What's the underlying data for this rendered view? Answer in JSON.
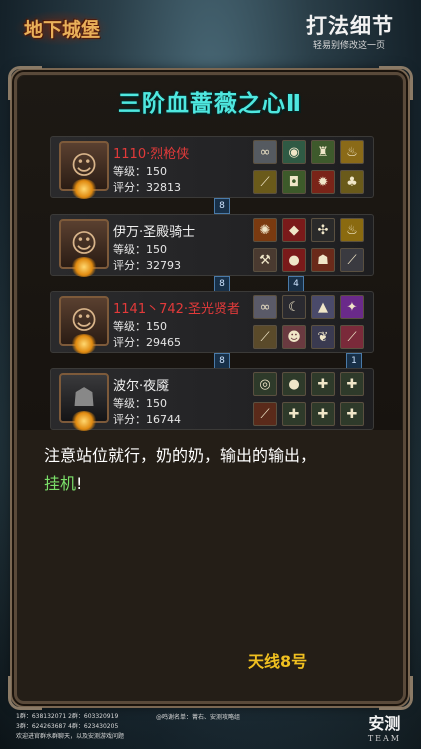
{
  "header": {
    "logo_text": "地下城堡",
    "title": "打法细节",
    "subtitle": "轻易别修改这一页"
  },
  "boss_title": "三阶血蔷薇之心Ⅱ",
  "members": [
    {
      "name": "1110·烈枪侠",
      "name_color": "red",
      "level": "等级：150",
      "score": "评分：32813",
      "portrait_icon": "female-warrior-portrait",
      "skills": [
        {
          "icon": "chain-icon",
          "bg": "#555a60",
          "glyph": "∞"
        },
        {
          "icon": "swirl-icon",
          "bg": "#2f5a44",
          "glyph": "◉"
        },
        {
          "icon": "totem-icon",
          "bg": "#3e5a2c",
          "glyph": "♜"
        },
        {
          "icon": "potion-icon",
          "bg": "#8a6a18",
          "glyph": "♨"
        },
        {
          "icon": "spear-icon",
          "bg": "#6a5a1a",
          "glyph": "⟋"
        },
        {
          "icon": "armor-icon",
          "bg": "#3d5a2a",
          "glyph": "◘"
        },
        {
          "icon": "fire-icon",
          "bg": "#7a2418",
          "glyph": "✹"
        },
        {
          "icon": "rune-icon",
          "bg": "#6a5a1a",
          "glyph": "♣"
        }
      ]
    },
    {
      "name": "伊万·圣殿骑士",
      "name_color": "white",
      "level": "等级：150",
      "score": "评分：32793",
      "portrait_icon": "blonde-knight-portrait",
      "skills": [
        {
          "icon": "flame-ring-icon",
          "bg": "#7a3a10",
          "glyph": "✺"
        },
        {
          "icon": "gem-icon",
          "bg": "#7a1a1a",
          "glyph": "◆"
        },
        {
          "icon": "claw-icon",
          "bg": "#2a2a2a",
          "glyph": "✣"
        },
        {
          "icon": "lantern-icon",
          "bg": "#8a6a10",
          "glyph": "♨"
        },
        {
          "icon": "hammer-icon",
          "bg": "#4a3a30",
          "glyph": "⚒"
        },
        {
          "icon": "red-orb-icon",
          "bg": "#7a1a1a",
          "glyph": "●"
        },
        {
          "icon": "demon-icon",
          "bg": "#6a2a1a",
          "glyph": "☗"
        },
        {
          "icon": "blade-icon",
          "bg": "#3a3a40",
          "glyph": "⟋"
        }
      ]
    },
    {
      "name": "1141丶742·圣光贤者",
      "name_color": "red",
      "level": "等级：150",
      "score": "评分：29465",
      "portrait_icon": "sage-woman-portrait",
      "skills": [
        {
          "icon": "chain-icon",
          "bg": "#5a5a68",
          "glyph": "∞"
        },
        {
          "icon": "scythe-icon",
          "bg": "#2a2a30",
          "glyph": "☾"
        },
        {
          "icon": "hood-icon",
          "bg": "#4a4a6a",
          "glyph": "▲"
        },
        {
          "icon": "magic-orb-icon",
          "bg": "#6a2a8a",
          "glyph": "✦"
        },
        {
          "icon": "staff-icon",
          "bg": "#5a4a2a",
          "glyph": "⟋"
        },
        {
          "icon": "mask-icon",
          "bg": "#6a3a40",
          "glyph": "☻"
        },
        {
          "icon": "wing-icon",
          "bg": "#3a3a50",
          "glyph": "❦"
        },
        {
          "icon": "dagger-icon",
          "bg": "#7a2a3a",
          "glyph": "⟋"
        }
      ]
    },
    {
      "name": "波尔·夜魇",
      "name_color": "white",
      "level": "等级：150",
      "score": "评分：16744",
      "portrait_icon": "hooded-assassin-portrait",
      "skills": [
        {
          "icon": "eye-icon",
          "bg": "#2e3a2a",
          "glyph": "◎"
        },
        {
          "icon": "bomb-icon",
          "bg": "#2e3a2a",
          "glyph": "●"
        },
        {
          "icon": "cross-icon",
          "bg": "#2e3a2a",
          "glyph": "✚"
        },
        {
          "icon": "cross-icon",
          "bg": "#2e3a2a",
          "glyph": "✚"
        },
        {
          "icon": "dagger-icon",
          "bg": "#5a2a1a",
          "glyph": "⟋"
        },
        {
          "icon": "cross-icon",
          "bg": "#2e3a2a",
          "glyph": "✚"
        },
        {
          "icon": "cross-icon",
          "bg": "#2e3a2a",
          "glyph": "✚"
        },
        {
          "icon": "cross-icon",
          "bg": "#2e3a2a",
          "glyph": "✚"
        }
      ]
    }
  ],
  "links": [
    "8",
    "8",
    "4",
    "8",
    "1"
  ],
  "description": {
    "line1": "注意站位就行，奶的奶，输出的输出，",
    "highlight": "挂机",
    "end": "!"
  },
  "caption": "天线8号",
  "footer": {
    "groups_line1": "1群：638132071   2群：603320919",
    "groups_line2": "3群：624263687   4群：623430205",
    "welcome": "欢迎进官群水群聊天，以及安测游戏问题",
    "credits": "@鸣谢名单：菁右、安测攻略组"
  },
  "brand": {
    "name": "安测",
    "team": "TEAM"
  }
}
